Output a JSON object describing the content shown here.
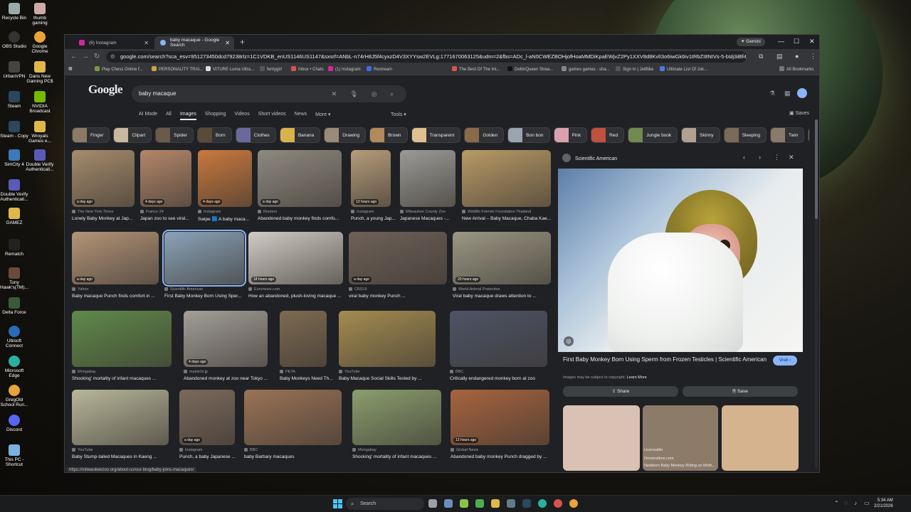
{
  "desktop": {
    "icons": [
      "Recycle Bin",
      "thumb gaming",
      "OBS Studio",
      "Google Chrome",
      "UrbanVPN",
      "Dans New Gaming PC$",
      "Steam",
      "NVIDIA Broadcast",
      "Steam - Copy",
      "Wroyals Games e...",
      "SimCity 4",
      "Double Verify Authenticati...",
      "Double Verify Authenticati...",
      "GAMEZ",
      "Rematch",
      "Tony Hawk's(TM)...",
      "Delta Force",
      "Ubisoft Connect",
      "Microsoft Edge",
      "GregOld School Run...",
      "Discord",
      "This PC - Shortcut"
    ]
  },
  "browser": {
    "tabs": [
      {
        "label": "(6) Instagram",
        "active": false
      },
      {
        "label": "baby macaque - Google Search",
        "active": true
      }
    ],
    "gemini_label": "Gemini",
    "url": "google.com/search?sca_esv=951273450dcd79238rlz=1C1VDKB_enUS1146US1147&sxsrf=ANbL-n74rH8J5f4cyxzD4V3XYYsw2EVLg:1771670063125&udm=2&fbs=ADc_l-aN0CWEZBOHjofHoaMMDiKpaEWjvZ2Py1XXV8d8KvlI3o6iwGk6iv1tRbZI8NIVs-5-bUj3iBf-UxHsANYwOk...",
    "bookmarks": [
      "Play Chess Online f...",
      "PERSONALITY TRAI...",
      "VITURE Luma Ultra...",
      "fentygirl",
      "Inbox • Chats",
      "(1) Instagram",
      "Restream",
      "The Best Of The Int...",
      "DeltinQueen Strea...",
      "games games - sha...",
      "Sign In | JetBike",
      "Ultimate List Of Jok..."
    ],
    "all_bookmarks": "All Bookmarks"
  },
  "google": {
    "logo": "Google",
    "query": "baby macaque",
    "filters": [
      "AI Mode",
      "All",
      "Images",
      "Shopping",
      "Videos",
      "Short videos",
      "News",
      "More ▾"
    ],
    "active_filter": "Images",
    "tools": "Tools ▾",
    "saves": "Saves",
    "chips": [
      "Finger",
      "Clipart",
      "Spider",
      "Born",
      "Clothes",
      "Banana",
      "Drawing",
      "Brown",
      "Transparent",
      "Golden",
      "Bon bon",
      "Pink",
      "Red",
      "Jungle book",
      "Skinny",
      "Sleeping",
      "Twin",
      "Tree"
    ]
  },
  "results": [
    {
      "src": "The New York Times",
      "title": "Lonely Baby Monkey at Jap...",
      "age": "a day ago",
      "color": "#a58c6c"
    },
    {
      "src": "France 24",
      "title": "Japan zoo to see viral...",
      "age": "4 days ago",
      "color": "#b3876a"
    },
    {
      "src": "Instagram",
      "title": "Swipe 🟦 A baby maca...",
      "age": "4 days ago",
      "color": "#c9793e"
    },
    {
      "src": "Reuters",
      "title": "Abandoned baby monkey finds comfo...",
      "age": "a day ago",
      "color": "#8f8a80"
    },
    {
      "src": "Instagram",
      "title": "Punch, a young Jap...",
      "age": "13 hours ago",
      "color": "#b59c7a"
    },
    {
      "src": "Milwaukee County Zoo",
      "title": "Japanese Macaques -...",
      "age": "",
      "color": "#9a9a96"
    },
    {
      "src": "Wildlife Friends Foundation Thailand",
      "title": "New Arrival – Baby Macaque, Chaba Kae...",
      "age": "",
      "color": "#b89a66"
    },
    {
      "src": "Yahoo",
      "title": "Baby macaque Punch finds comfort in ...",
      "age": "a day ago",
      "color": "#b39478"
    },
    {
      "src": "Scientific American",
      "title": "First Baby Monkey Born Using Sper...",
      "age": "",
      "color": "#8aa3b8"
    },
    {
      "src": "Euronews.com",
      "title": "How an abandoned, plush-loving macaque ...",
      "age": "18 hours ago",
      "color": "#d0cbc4"
    },
    {
      "src": "CBS19",
      "title": "viral baby monkey Punch ...",
      "age": "a day ago",
      "color": "#6e6158"
    },
    {
      "src": "World Animal Protection",
      "title": "Viral baby macaque draws attention to ...",
      "age": "20 hours ago",
      "color": "#9b9784"
    },
    {
      "src": "Mongabay",
      "title": "Shocking' mortality of infant macaques ...",
      "age": "",
      "color": "#5f8a4a"
    },
    {
      "src": "mainichi.jp",
      "title": "Abandoned monkey at zoo near Tokyo ...",
      "age": "4 days ago",
      "color": "#a29e98"
    },
    {
      "src": "PETA",
      "title": "Baby Monkeys Need Th...",
      "age": "",
      "color": "#7d6b52"
    },
    {
      "src": "YouTube",
      "title": "Baby Macaque Social Skills Tested by ...",
      "age": "",
      "color": "#a48c50"
    },
    {
      "src": "BBC",
      "title": "Critically endangered monkey born at zoo",
      "age": "",
      "color": "#4d5466"
    },
    {
      "src": "YouTube",
      "title": "Baby Stump-tailed Macaques in Kaeng ...",
      "age": "",
      "color": "#b7b79a"
    },
    {
      "src": "Instagram",
      "title": "Punch, a baby Japanese ...",
      "age": "a day ago",
      "color": "#7b6a5c"
    },
    {
      "src": "BBC",
      "title": "baby Barbary macaques",
      "age": "",
      "color": "#9a7356"
    },
    {
      "src": "Mongabay",
      "title": "Shocking' mortality of infant macaques ...",
      "age": "",
      "color": "#8a9e6e"
    },
    {
      "src": "Global News",
      "title": "Abandoned baby monkey Punch dragged by ...",
      "age": "13 hours ago",
      "color": "#a7643e"
    }
  ],
  "panel": {
    "source": "Scientific American",
    "title": "First Baby Monkey Born Using Sperm from Frozen Testicles | Scientific American",
    "visit": "Visit ›",
    "note": "Images may be subject to copyright.",
    "learn_more": "Learn More",
    "share": "Share",
    "save": "Save",
    "related": [
      {
        "src": "",
        "title": "",
        "color": "#d9c2b4"
      },
      {
        "src": "Licensable",
        "title": "",
        "color": "#8d7b69"
      },
      {
        "src": "",
        "title": "",
        "color": "#d6b38f"
      }
    ],
    "related_src2": "Dreamstime.com",
    "related_title2": "Newborn Baby Monkey Riding on Moth..."
  },
  "status_url": "https://milwaukeezoo.org/about-us/our-blog/baby-joins-macaques/",
  "taskbar": {
    "search": "Search",
    "time": "5:34 AM",
    "date": "2/21/2026"
  }
}
